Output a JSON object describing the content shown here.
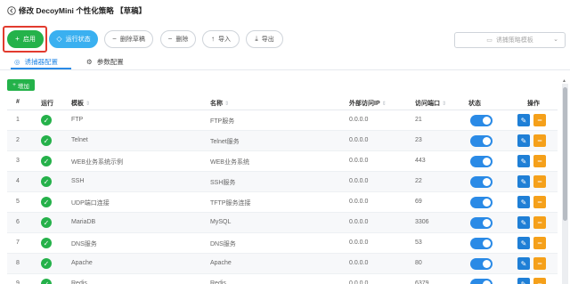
{
  "title": "修改 DecoyMini 个性化策略 【草稿】",
  "toolbar": {
    "apply": "启用",
    "status": "运行状态",
    "delete_draft": "删除草稿",
    "delete": "删除",
    "import": "导入",
    "export": "导出",
    "template_placeholder": "诱捕策略模板"
  },
  "tabs": [
    {
      "label": "诱捕器配置",
      "active": true
    },
    {
      "label": "参数配置",
      "active": false
    }
  ],
  "add_label": "增加",
  "columns": [
    "#",
    "运行",
    "模板",
    "名称",
    "外部访问IP",
    "访问端口",
    "状态",
    "操作"
  ],
  "rows": [
    {
      "num": "1",
      "template": "FTP",
      "name": "FTP服务",
      "ip": "0.0.0.0",
      "port": "21",
      "enabled": true
    },
    {
      "num": "2",
      "template": "Telnet",
      "name": "Telnet服务",
      "ip": "0.0.0.0",
      "port": "23",
      "enabled": true
    },
    {
      "num": "3",
      "template": "WEB业务系统示例",
      "name": "WEB业务系统",
      "ip": "0.0.0.0",
      "port": "443",
      "enabled": true
    },
    {
      "num": "4",
      "template": "SSH",
      "name": "SSH服务",
      "ip": "0.0.0.0",
      "port": "22",
      "enabled": true
    },
    {
      "num": "5",
      "template": "UDP端口连接",
      "name": "TFTP服务连接",
      "ip": "0.0.0.0",
      "port": "69",
      "enabled": true
    },
    {
      "num": "6",
      "template": "MariaDB",
      "name": "MySQL",
      "ip": "0.0.0.0",
      "port": "3306",
      "enabled": true
    },
    {
      "num": "7",
      "template": "DNS服务",
      "name": "DNS服务",
      "ip": "0.0.0.0",
      "port": "53",
      "enabled": true
    },
    {
      "num": "8",
      "template": "Apache",
      "name": "Apache",
      "ip": "0.0.0.0",
      "port": "80",
      "enabled": true
    },
    {
      "num": "9",
      "template": "Redis",
      "name": "Redis",
      "ip": "0.0.0.0",
      "port": "6379",
      "enabled": true
    }
  ],
  "colors": {
    "green": "#24b24a",
    "blue": "#3ab0f0",
    "primary": "#2a8ae6",
    "orange": "#f5a01a",
    "highlight": "#e23b2e"
  }
}
